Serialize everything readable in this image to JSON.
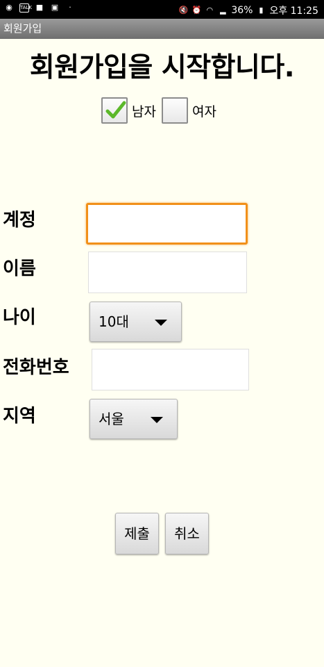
{
  "status_bar": {
    "icons_left": [
      "messenger-icon",
      "talk-icon",
      "video-icon",
      "gallery-icon",
      "dot-icon"
    ],
    "icons_right": [
      "mute-icon",
      "alarm-icon",
      "wifi-icon",
      "signal-icon",
      "battery-icon"
    ],
    "battery": "36%",
    "time": "오후 11:25"
  },
  "app": {
    "title": "회원가입"
  },
  "headline": "회원가입을 시작합니다.",
  "gender": {
    "male": {
      "label": "남자",
      "checked": true
    },
    "female": {
      "label": "여자",
      "checked": false
    }
  },
  "form": {
    "account": {
      "label": "계정",
      "value": ""
    },
    "name": {
      "label": "이름",
      "value": ""
    },
    "age": {
      "label": "나이",
      "selected": "10대"
    },
    "phone": {
      "label": "전화번호",
      "value": ""
    },
    "region": {
      "label": "지역",
      "selected": "서울"
    }
  },
  "buttons": {
    "submit": "제출",
    "cancel": "취소"
  },
  "colors": {
    "background": "#fffff2",
    "focus": "#f19019",
    "check": "#5cb82a"
  }
}
